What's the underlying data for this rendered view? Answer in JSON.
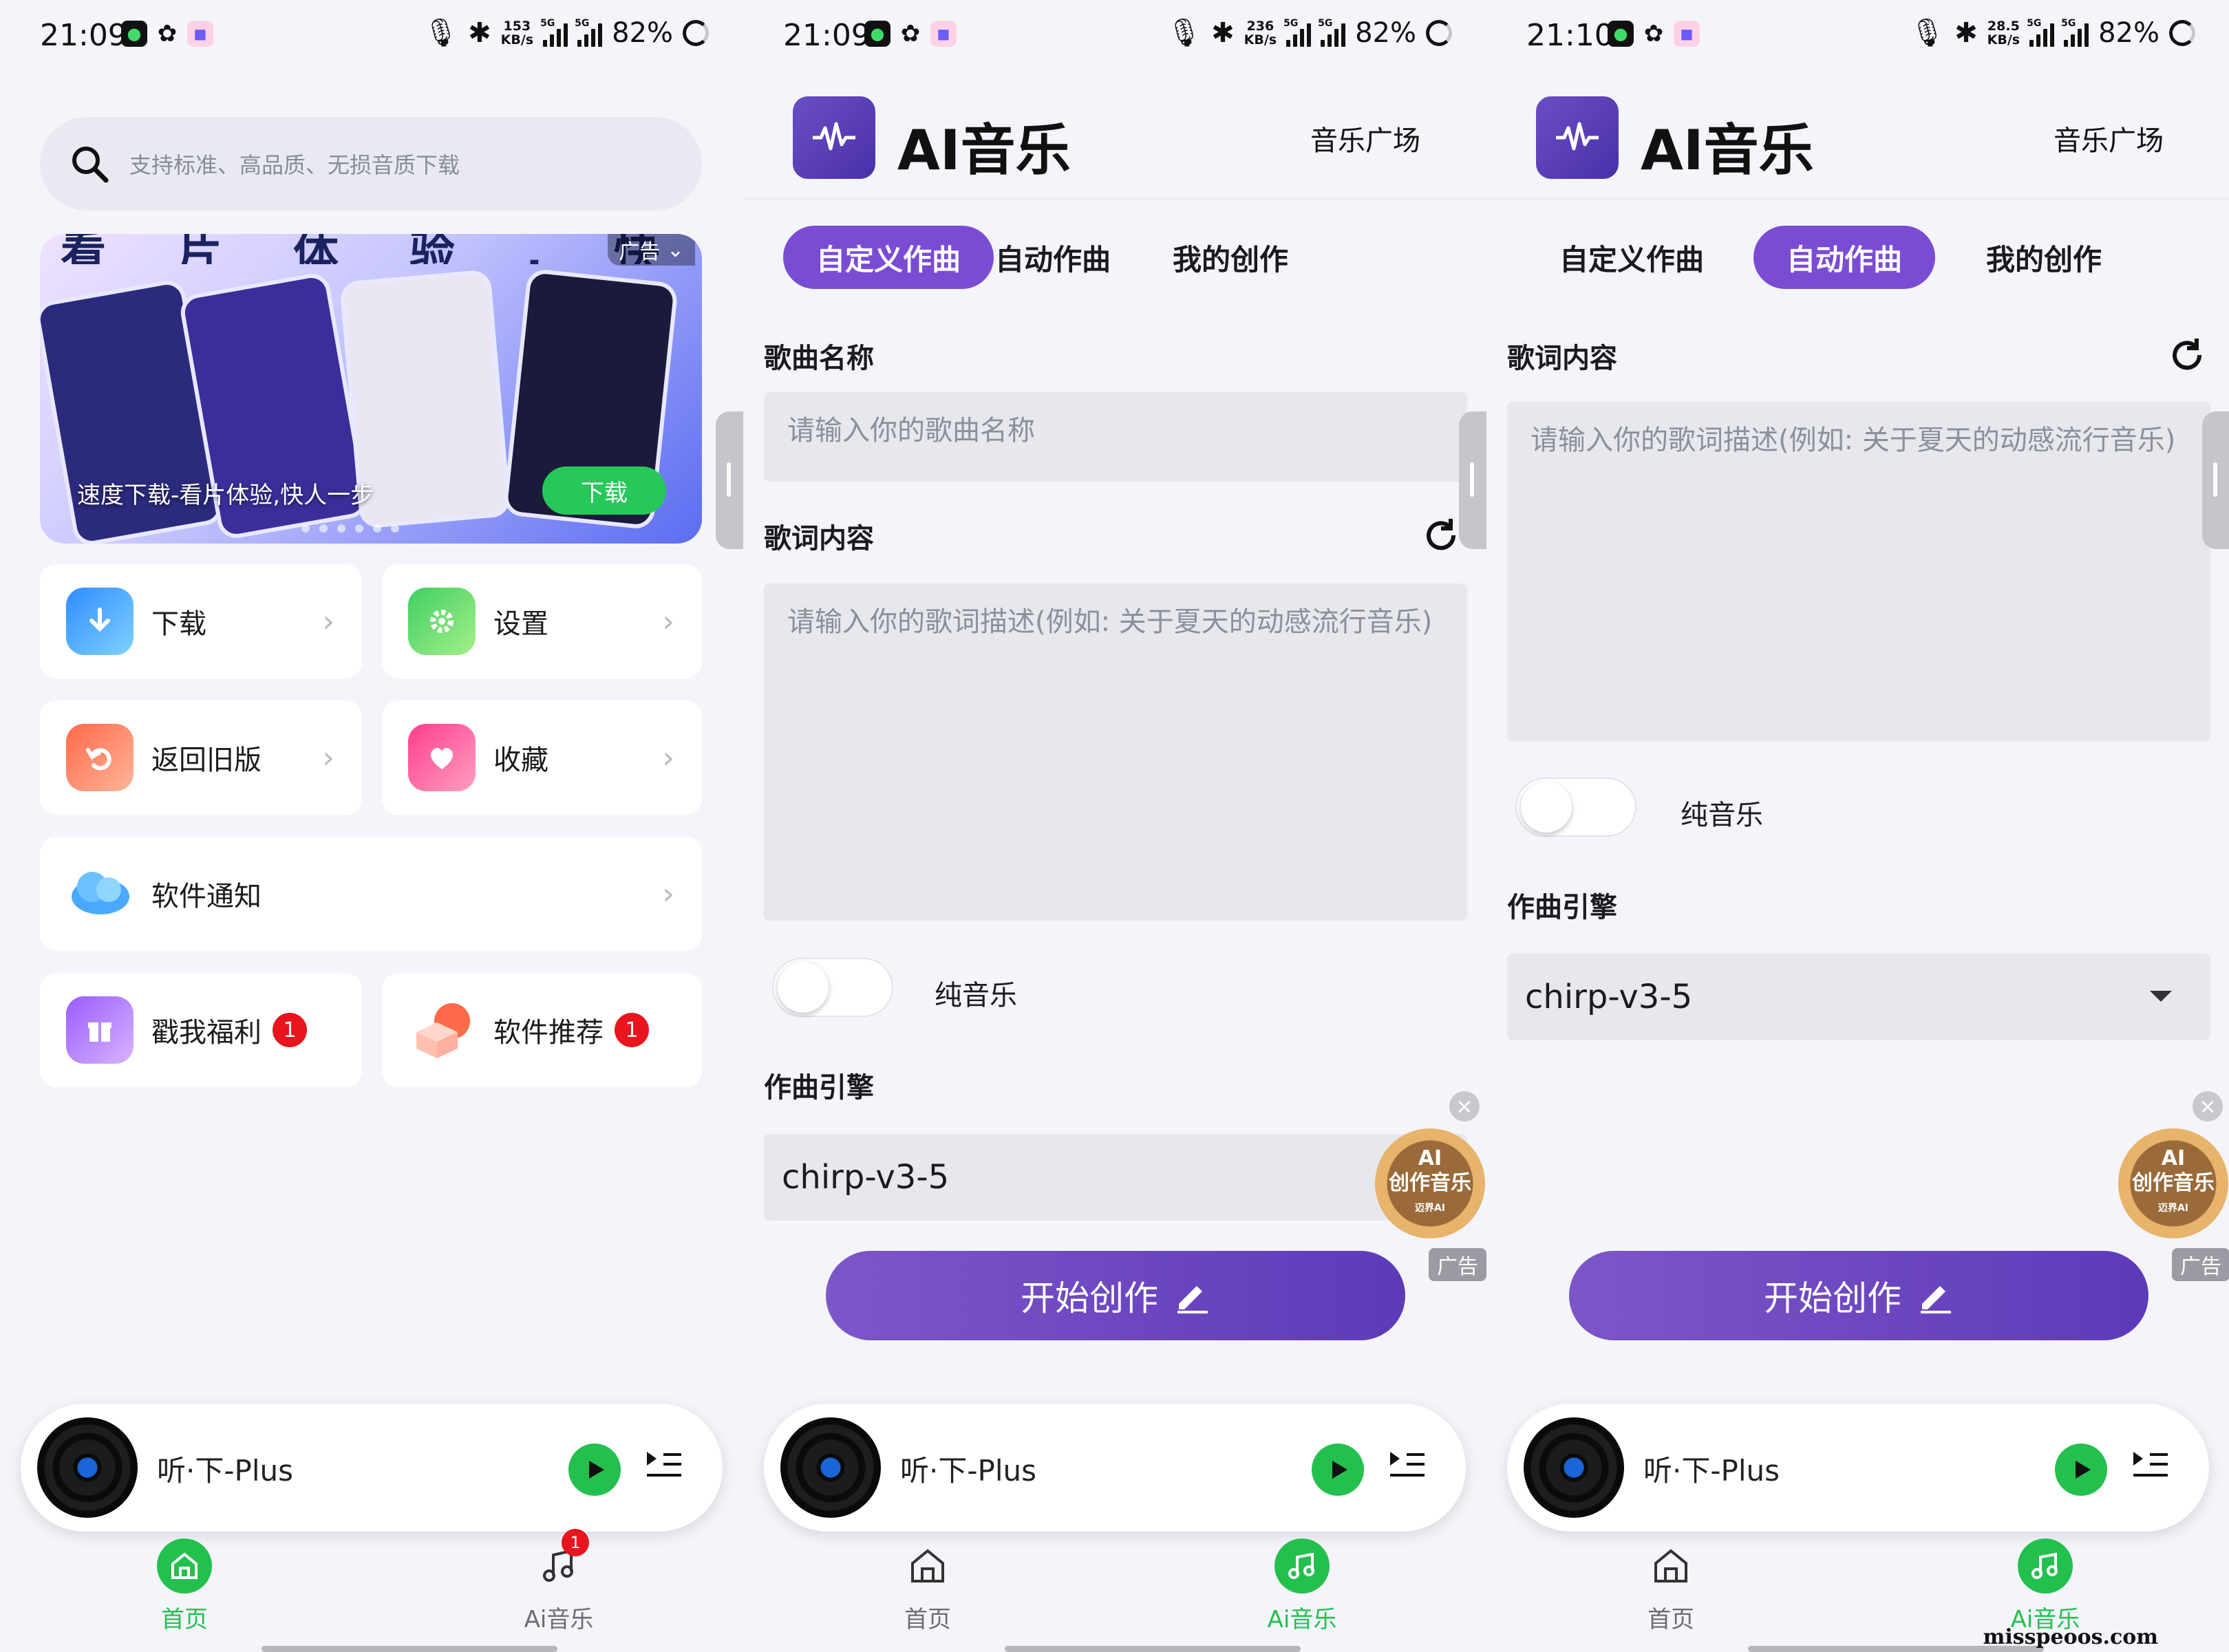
{
  "status": [
    {
      "time": "21:09",
      "speed_top": "153",
      "speed_bottom": "KB/s",
      "battery": "82%",
      "net": "5G"
    },
    {
      "time": "21:09",
      "speed_top": "236",
      "speed_bottom": "KB/s",
      "battery": "82%",
      "net": "5G"
    },
    {
      "time": "21:10",
      "speed_top": "28.5",
      "speed_bottom": "KB/s",
      "battery": "82%",
      "net": "5G"
    }
  ],
  "home": {
    "search_placeholder": "支持标准、高品质、无损音质下载",
    "banner": {
      "top_text": "看 片 体 验 , 快 人 一",
      "ad_label": "广告",
      "caption": "速度下载-看片体验,快人一步",
      "button": "下载"
    },
    "cards": [
      {
        "label": "下载",
        "icon": "download-icon"
      },
      {
        "label": "设置",
        "icon": "gear-icon"
      },
      {
        "label": "返回旧版",
        "icon": "undo-icon"
      },
      {
        "label": "收藏",
        "icon": "heart-icon"
      },
      {
        "label": "软件通知",
        "icon": "cloud-icon"
      },
      {
        "label": "戳我福利",
        "icon": "gift-icon",
        "badge": "1"
      },
      {
        "label": "软件推荐",
        "icon": "cube-icon",
        "badge": "1"
      }
    ]
  },
  "ai": {
    "app_title": "AI音乐",
    "plaza": "音乐广场",
    "tabs": [
      "自定义作曲",
      "自动作曲",
      "我的创作"
    ],
    "song_name_label": "歌曲名称",
    "song_name_placeholder": "请输入你的歌曲名称",
    "lyrics_label": "歌词内容",
    "lyrics_placeholder": "请输入你的歌词描述(例如: 关于夏天的动感流行音乐)",
    "pure_music": "纯音乐",
    "engine_label": "作曲引擎",
    "engine_value": "chirp-v3-5",
    "create_button": "开始创作",
    "float_ad": {
      "line1": "AI",
      "line2": "创作音乐",
      "line3": "迈界AI",
      "tag": "广告",
      "close": "×"
    }
  },
  "player": {
    "track": "听·下-Plus"
  },
  "nav": {
    "home": "首页",
    "ai_music": "Ai音乐",
    "badge": "1"
  },
  "watermark": "misspeoos.com",
  "colors": {
    "accent_purple": "#7a4cd4",
    "green": "#23c04e",
    "badge_red": "#e8141e"
  }
}
